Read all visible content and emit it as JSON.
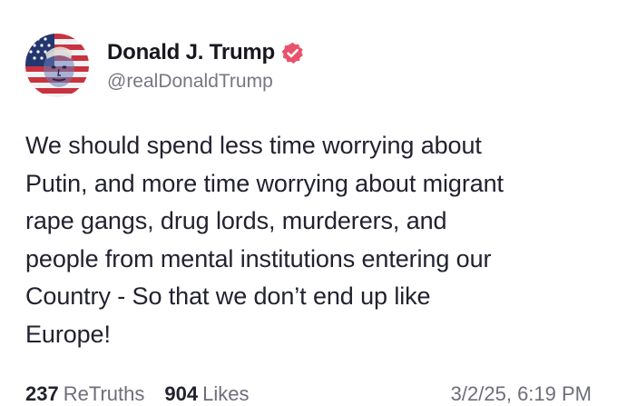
{
  "author": {
    "display_name": "Donald J. Trump",
    "handle": "@realDonaldTrump",
    "verified_icon": "verified-badge-icon",
    "accent_color": "#e8526c",
    "avatar": "flag-portrait-avatar"
  },
  "post": {
    "text": "We should spend less time worrying about\nPutin, and more time worrying about migrant\nrape gangs, drug lords, murderers, and\npeople from mental institutions entering our\nCountry - So that we don’t end up like\nEurope!"
  },
  "stats": {
    "retruths_count": "237",
    "retruths_label": "ReTruths",
    "likes_count": "904",
    "likes_label": "Likes",
    "timestamp": "3/2/25, 6:19 PM"
  }
}
